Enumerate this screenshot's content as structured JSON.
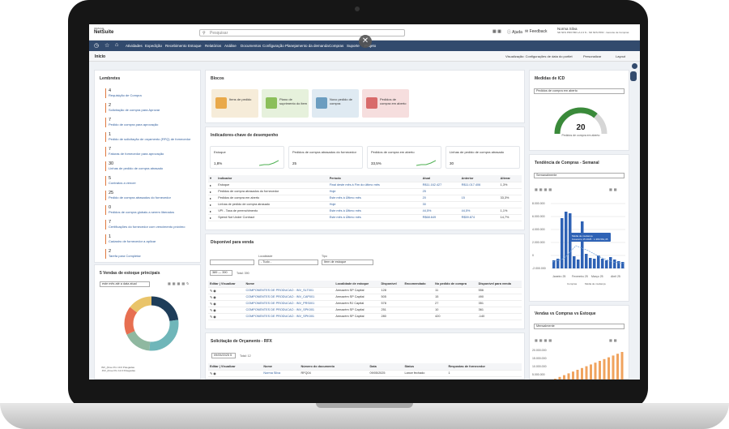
{
  "app": {
    "logo_top": "ORACLE",
    "logo_main": "NetSuite"
  },
  "search": {
    "placeholder": "Pesquisar"
  },
  "topbar": {
    "help": "Ajuda",
    "feedback": "Feedback",
    "user_name": "Norma Silva",
    "user_line2": "SD NFS PRIV BR LA 2.2 N - SD NFS PRIV - Gerente de Compras"
  },
  "nav": {
    "items": [
      "Atividades",
      "Expedição",
      "Recebimento",
      "Estoque",
      "Relatórios",
      "Análise",
      "Documentos",
      "Configuração",
      "Planejamento da demanda",
      "Compras",
      "Suporte",
      "Projeto"
    ]
  },
  "subbar": {
    "title": "Início",
    "view": "Visualização: Configurações de data do portlet",
    "personalize": "Personalizar",
    "layout": "Layout"
  },
  "reminders": {
    "title": "Lembretes",
    "items": [
      {
        "n": "4",
        "l": "Requisição de Compra"
      },
      {
        "n": "2",
        "l": "Solicitação de compra para Aprovar"
      },
      {
        "n": "7",
        "l": "Pedido de compra para aprovação"
      },
      {
        "n": "1",
        "l": "Pedido de solicitação de orçamento (RFQ) de fornecedor"
      },
      {
        "n": "7",
        "l": "Faturas de fornecedor para aprovação"
      },
      {
        "n": "30",
        "l": "Linhas de pedido de compra atrasado"
      },
      {
        "n": "5",
        "l": "Contratos a vencer"
      },
      {
        "n": "25",
        "l": "Pedido de compra atrasados do fornecedor"
      },
      {
        "n": "0",
        "l": "Pedidos de compra globais a serem liberados"
      },
      {
        "n": "7",
        "l": "Certificações do fornecedor com vencimento próximo"
      },
      {
        "n": "1",
        "l": "Cadastro de fornecedor a aplicar"
      },
      {
        "n": "2",
        "l": "Tarefa para Completar"
      }
    ]
  },
  "top5": {
    "title": "5 Vendas de estoque principais",
    "filter": "este mês até a data atual",
    "legend": [
      "INV_(Free Pro 10.0 Polegadas",
      ".INV_(Free Pro 12.0 Polegadas"
    ]
  },
  "blocks": {
    "title": "Blocos",
    "tiles": [
      "Itens de pedido",
      "Plano de suprimento do item",
      "Novo pedido de compra",
      "Pedidos de compra em aberto"
    ]
  },
  "kpi": {
    "title": "Indicadores-chave de desempenho",
    "cards": [
      {
        "label": "Estoque",
        "value": "1,8%"
      },
      {
        "label": "Pedidos de compra atrasados do fornecedor",
        "value": "25"
      },
      {
        "label": "Pedidos de compra em aberto",
        "value": "33,5%"
      },
      {
        "label": "Linhas de pedido de compra atrasado",
        "value": "30"
      }
    ],
    "headers": [
      "Indicador",
      "Período",
      "Atual",
      "Anterior",
      "Alterar"
    ],
    "rows": [
      [
        "Estoque",
        "Final deste mês à Fim do último mês",
        "R$11.162.427",
        "R$11.017.406",
        "1,3%"
      ],
      [
        "Pedidos de compra atrasados do fornecedor",
        "Hoje",
        "25",
        "",
        ""
      ],
      [
        "Pedidos de compra em aberto",
        "Este mês à Último mês",
        "20",
        "15",
        "33,3%"
      ],
      [
        "Linhas de pedido de compra atrasado",
        "Hoje",
        "30",
        "",
        ""
      ],
      [
        "VPI - Taxa de preenchimento",
        "Este mês à Último mês",
        "44,5%",
        "44,5%",
        "1,1%"
      ],
      [
        "Spend Not Under Contract",
        "Este mês à Último mês",
        "R$68.649",
        "R$59.874",
        "14,7%"
      ]
    ]
  },
  "avail": {
    "title": "Disponível para venda",
    "loc_label": "Localidade",
    "loc_val": "- Tudo -",
    "type_label": "Tipo",
    "type_val": "Item de estoque",
    "pager": "389 — 390",
    "total": "Total: 390",
    "headers": [
      "Editar | Visualizar",
      "Nome",
      "Localidade de estoque",
      "Disponível",
      "Encomendado",
      "No pedido de compra",
      "Disponível para venda"
    ],
    "rows": [
      [
        "COMPONENTES DE PRODUCAO : INV_SLT001",
        "Armazém SP Capital",
        "128",
        "",
        "11",
        "556"
      ],
      [
        "COMPONENTES DE PRODUCAO : INV_CAP001",
        "Armazém SP Capital",
        "505",
        "",
        "15",
        "490"
      ],
      [
        "COMPONENTES DE PRODUCAO : INV_PRS001",
        "Armazém RJ Capital",
        "578",
        "",
        "27",
        "351"
      ],
      [
        "COMPONENTES DE PRODUCAO : INV_SPK001",
        "Armazém SP Capital",
        "251",
        "",
        "10",
        "361"
      ],
      [
        "COMPONENTES DE PRODUCAO : INV_SPK001",
        "Armazém SP Capital",
        "280",
        "",
        "420",
        "-140"
      ]
    ]
  },
  "rfq": {
    "title": "Solicitação de Orçamento - RFX",
    "filter": "09/05/2025 5",
    "total": "Total: 12",
    "headers": [
      "Editar | Visualizar",
      "Nome",
      "Número do documento",
      "Data",
      "Status",
      "Respostas de fornecedor"
    ],
    "rows": [
      [
        "Norma Silva",
        "RFQ04",
        "09/05/2025",
        "Lance fechado",
        "1"
      ]
    ]
  },
  "gauge": {
    "title": "Medidas de ICD",
    "select": "Pedidos de compra em aberto",
    "value": "20",
    "caption": "Pedidos de compra em aberto",
    "accent": "#3a8a3a"
  },
  "trend": {
    "title": "Tendência de Compras - Semanal",
    "select": "Semanalmente",
    "tooltip_l1": "Média de mudança",
    "tooltip_l2": "Fevereiro 15 2025 : 1.366.561,45",
    "yticks": [
      "8.000.000",
      "6.000.000",
      "4.000.000",
      "2.000.000",
      "0",
      "-2.000.000"
    ],
    "xticks": [
      "Janeiro 25",
      "Fevereiro 25",
      "Março 25",
      "Abril 25"
    ],
    "legend": [
      "Compras",
      "Média de mudança"
    ]
  },
  "vendas": {
    "title": "Vendas vs Compras vs Estoque",
    "select": "Mensalmente",
    "yticks": [
      "20.000.000",
      "15.000.000",
      "10.000.000",
      "5.000.000"
    ]
  }
}
